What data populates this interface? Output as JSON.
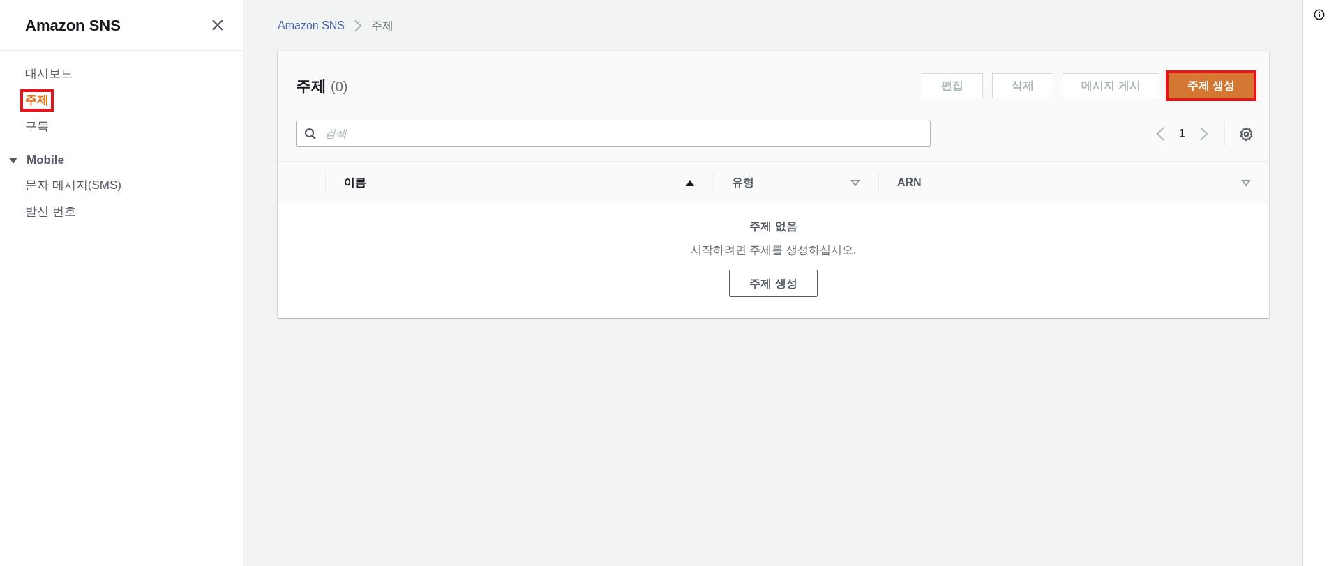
{
  "sidebar": {
    "title": "Amazon SNS",
    "items": [
      {
        "label": "대시보드",
        "selected": false,
        "highlighted": false
      },
      {
        "label": "주제",
        "selected": true,
        "highlighted": true
      },
      {
        "label": "구독",
        "selected": false,
        "highlighted": false
      }
    ],
    "sections": [
      {
        "title": "Mobile",
        "expanded": true,
        "items": [
          {
            "label": "문자 메시지(SMS)",
            "selected": false
          },
          {
            "label": "발신 번호",
            "selected": false
          }
        ]
      }
    ]
  },
  "breadcrumb": [
    {
      "label": "Amazon SNS",
      "kind": "link"
    },
    {
      "label": "주제",
      "kind": "current"
    }
  ],
  "panel": {
    "title": "주제",
    "count": "(0)",
    "actions": [
      {
        "label": "편집",
        "kind": "normal",
        "disabled": true,
        "highlighted": false
      },
      {
        "label": "삭제",
        "kind": "normal",
        "disabled": true,
        "highlighted": false
      },
      {
        "label": "메시지 게시",
        "kind": "normal",
        "disabled": true,
        "highlighted": false
      },
      {
        "label": "주제 생성",
        "kind": "primary",
        "disabled": false,
        "highlighted": true
      }
    ],
    "search": {
      "placeholder": "검색"
    },
    "pagination": {
      "page": "1",
      "prev_disabled": true,
      "next_disabled": true
    },
    "columns": [
      {
        "label": "이름",
        "sorted": true
      },
      {
        "label": "유형",
        "sorted": false
      },
      {
        "label": "ARN",
        "sorted": false
      }
    ],
    "empty": {
      "title": "주제 없음",
      "message": "시작하려면 주제를 생성하십시오.",
      "button": "주제 생성"
    }
  }
}
